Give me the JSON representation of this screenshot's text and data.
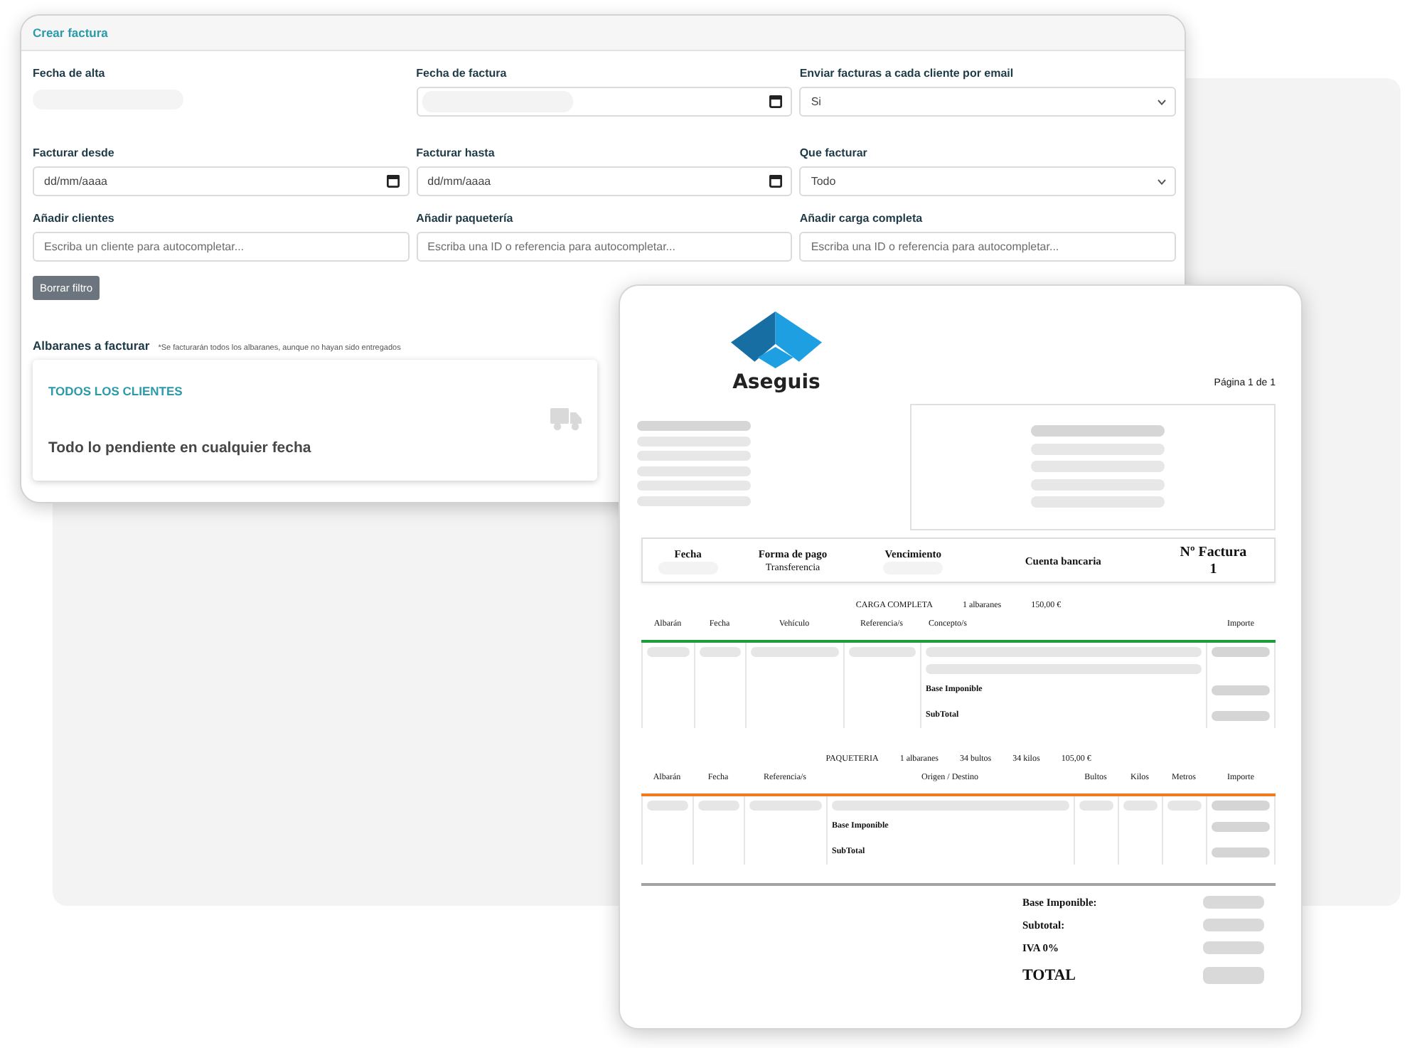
{
  "form_window": {
    "title": "Crear factura",
    "rows": [
      [
        {
          "kind": "static",
          "label": "Fecha de alta",
          "redacted": true
        },
        {
          "kind": "date",
          "label": "Fecha de factura",
          "redacted": true
        },
        {
          "kind": "select",
          "label": "Enviar facturas a cada cliente por email",
          "value": "Si"
        }
      ],
      [
        {
          "kind": "date",
          "label": "Facturar desde",
          "placeholder": "dd/mm/aaaa",
          "redacted": false
        },
        {
          "kind": "date",
          "label": "Facturar hasta",
          "placeholder": "dd/mm/aaaa",
          "redacted": false
        },
        {
          "kind": "select",
          "label": "Que facturar",
          "value": "Todo"
        }
      ],
      [
        {
          "kind": "text",
          "label": "Añadir clientes",
          "placeholder": "Escriba un cliente para autocompletar..."
        },
        {
          "kind": "text",
          "label": "Añadir paquetería",
          "placeholder": "Escriba una ID o referencia para autocompletar..."
        },
        {
          "kind": "text",
          "label": "Añadir carga completa",
          "placeholder": "Escriba una ID o referencia para autocompletar..."
        }
      ]
    ],
    "clear_button": "Borrar filtro",
    "delivery_notes": {
      "heading": "Albaranes a facturar",
      "note": "*Se facturarán todos los albaranes, aunque no hayan sido entregados",
      "card": {
        "title": "TODOS LOS CLIENTES",
        "description": "Todo lo pendiente en cualquier fecha"
      }
    }
  },
  "invoice": {
    "brand": "Aseguis",
    "page": "Página 1 de 1",
    "info": [
      {
        "kind": "field",
        "label": "Fecha",
        "redacted": true
      },
      {
        "kind": "field",
        "label": "Forma de pago",
        "value": "Transferencia",
        "redacted": false
      },
      {
        "kind": "field",
        "label": "Vencimiento",
        "redacted": true
      },
      {
        "kind": "field",
        "label": "Cuenta bancaria",
        "redacted": false
      },
      {
        "kind": "number",
        "label": "Nº Factura",
        "value": "1",
        "redacted": false
      }
    ],
    "sections": [
      {
        "title": "CARGA COMPLETA",
        "color": "#1e9e3a",
        "summary": [
          "1 albaranes",
          "150,00 €"
        ],
        "columns": [
          "Albarán",
          "Fecha",
          "Vehículo",
          "Referencia/s",
          "Concepto/s",
          "Importe"
        ],
        "subtotals": [
          "Base Imponible",
          "SubTotal"
        ]
      },
      {
        "title": "PAQUETERIA",
        "color": "#f27a1f",
        "summary": [
          "1 albaranes",
          "34 bultos",
          "34 kilos",
          "105,00 €"
        ],
        "columns": [
          "Albarán",
          "Fecha",
          "Referencia/s",
          "Origen / Destino",
          "Bultos",
          "Kilos",
          "Metros",
          "Importe"
        ],
        "subtotals": [
          "Base Imponible",
          "SubTotal"
        ]
      }
    ],
    "totals": [
      {
        "kind": "line",
        "label": "Base Imponible:"
      },
      {
        "kind": "line",
        "label": "Subtotal:"
      },
      {
        "kind": "line",
        "label": "IVA 0%"
      },
      {
        "kind": "grand",
        "label": "TOTAL"
      }
    ]
  }
}
